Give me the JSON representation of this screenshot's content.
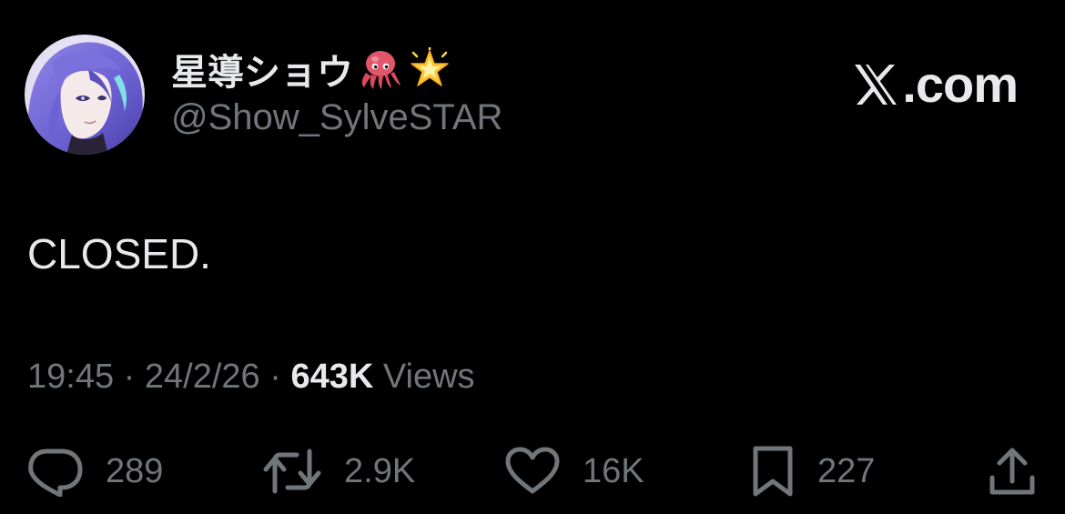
{
  "author": {
    "display_name": "星導ショウ",
    "emojis": [
      "octopus-emoji",
      "glowing-star-emoji"
    ],
    "handle": "@Show_SylveSTAR"
  },
  "brand": {
    "label": ".com",
    "logo": "x-logo-icon"
  },
  "post": {
    "text": "CLOSED."
  },
  "meta": {
    "time": "19:45",
    "separator": "·",
    "date": "24/2/26",
    "views_count": "643K",
    "views_label": "Views"
  },
  "actions": {
    "replies": {
      "icon": "reply-icon",
      "count": "289"
    },
    "reposts": {
      "icon": "repost-icon",
      "count": "2.9K"
    },
    "likes": {
      "icon": "heart-icon",
      "count": "16K"
    },
    "bookmarks": {
      "icon": "bookmark-icon",
      "count": "227"
    },
    "share": {
      "icon": "share-icon"
    }
  },
  "colors": {
    "background": "#000000",
    "primary_text": "#e7e9ea",
    "secondary_text": "#71767b"
  }
}
